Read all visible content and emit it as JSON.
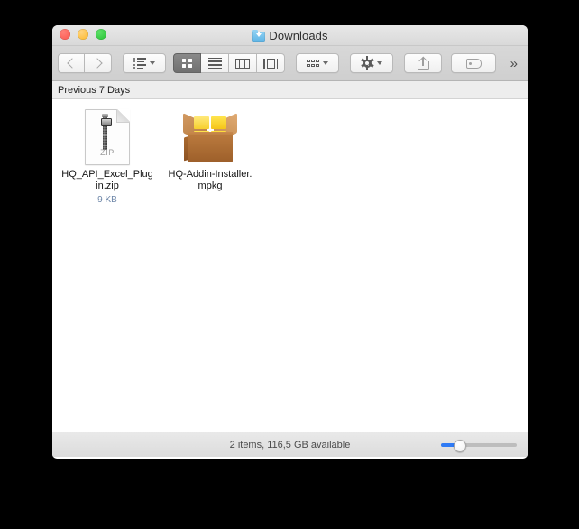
{
  "window": {
    "title": "Downloads",
    "title_icon": "downloads-folder-icon",
    "traffic_lights": {
      "close": "close-button",
      "minimize": "minimize-button",
      "maximize": "maximize-button"
    }
  },
  "toolbar": {
    "back_label": "Back",
    "forward_label": "Forward",
    "arrange_group_label": "Group Items",
    "view_icon_label": "Icon View",
    "view_list_label": "List View",
    "view_column_label": "Column View",
    "view_coverflow_label": "Cover Flow View",
    "arrange_label": "Arrange By",
    "action_label": "Action",
    "share_label": "Share",
    "tags_label": "Edit Tags",
    "overflow_label": "»"
  },
  "section": {
    "header": "Previous 7 Days"
  },
  "files": [
    {
      "name": "HQ_API_Excel_Plugin.zip",
      "size": "9 KB",
      "icon": "zip-archive-icon",
      "icon_caption": "ZIP"
    },
    {
      "name": "HQ-Addin-Installer.mpkg",
      "size": "",
      "icon": "installer-package-icon",
      "icon_caption": ""
    }
  ],
  "statusbar": {
    "text": "2 items, 116,5 GB available",
    "zoom_slider_label": "Icon Size"
  },
  "colors": {
    "accent": "#2f7bf5",
    "size_text": "#6d86a8",
    "window_chrome": "#d8d8d8",
    "desktop_background": "#000000"
  }
}
